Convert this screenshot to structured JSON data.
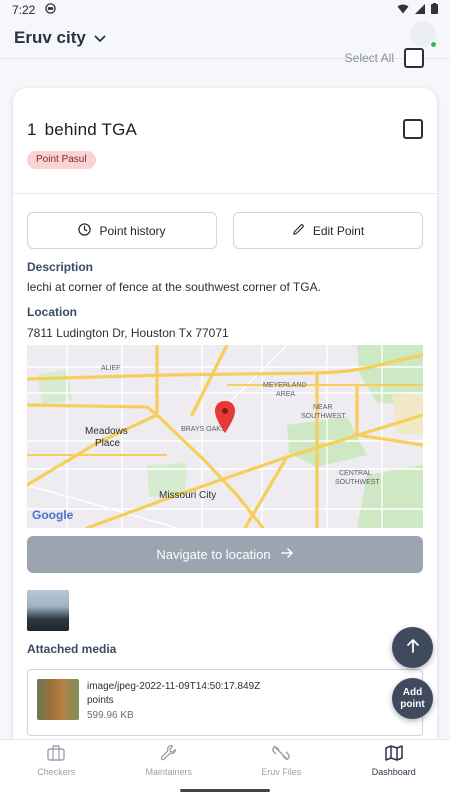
{
  "status_bar": {
    "time": "7:22"
  },
  "header": {
    "city": "Eruv city"
  },
  "select_all": {
    "label": "Select All"
  },
  "point": {
    "number": "1",
    "title": "behind TGA",
    "badge": "Point Pasul",
    "buttons": {
      "history": "Point history",
      "edit": "Edit Point"
    },
    "description_label": "Description",
    "description": "lechi at corner of fence at the southwest corner of TGA.",
    "location_label": "Location",
    "address": "7811 Ludington Dr, Houston Tx 77071",
    "navigate_label": "Navigate to location",
    "attached_media_label": "Attached media"
  },
  "map": {
    "labels": {
      "alief": "ALIEF",
      "meyerland": "MEYERLAND",
      "area": "AREA",
      "meadows1": "Meadows",
      "meadows2": "Place",
      "brays": "BRAYS OAKS",
      "near": "NEAR",
      "southwest": "SOUTHWEST",
      "central": "CENTRAL",
      "central_sw": "SOUTHWEST",
      "missouri": "Missouri City",
      "google": "Google"
    }
  },
  "media": {
    "filename": "image/jpeg-2022-11-09T14:50:17.849Z",
    "subtitle": "points",
    "size": "599.96 KB"
  },
  "fab": {
    "add_line1": "Add",
    "add_line2": "point"
  },
  "bottom_nav": {
    "items": [
      {
        "label": "Checkers",
        "icon": "briefcase-icon"
      },
      {
        "label": "Maintainers",
        "icon": "wrench-icon"
      },
      {
        "label": "Eruv Files",
        "icon": "unlink-icon"
      },
      {
        "label": "Dashboard",
        "icon": "map-icon"
      }
    ]
  },
  "colors": {
    "accent": "#3f4a5e",
    "badge_bg": "#fbd3d3",
    "navigate_bg": "#9da4b1",
    "online": "#2dbb5a"
  }
}
